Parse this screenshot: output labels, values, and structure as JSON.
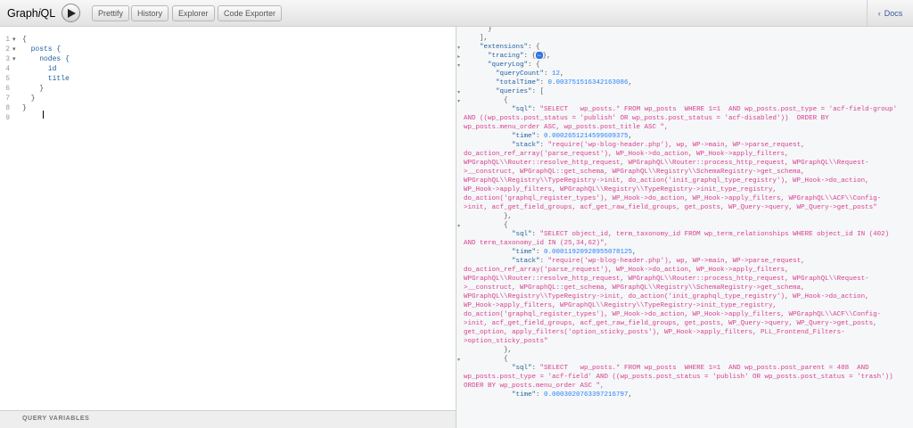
{
  "app": {
    "title_prefix": "Graph",
    "title_italic": "i",
    "title_suffix": "QL"
  },
  "toolbar": {
    "run_icon": "play-icon",
    "prettify_label": "Prettify",
    "history_label": "History",
    "explorer_label": "Explorer",
    "code_exporter_label": "Code Exporter",
    "docs_label": "Docs",
    "docs_icon": "chevron-left-icon"
  },
  "editor": {
    "line_numbers": [
      "1",
      "2",
      "3",
      "4",
      "5",
      "6",
      "7",
      "8",
      "9"
    ],
    "lines": [
      "{",
      "  posts {",
      "    nodes {",
      "      id",
      "      title",
      "    }",
      "  }",
      "}",
      ""
    ],
    "query_variables_label": "QUERY VARIABLES"
  },
  "colors": {
    "keyword": "#1f61a0",
    "number": "#2882f9",
    "string": "#d64292",
    "pill": "#2f74e6"
  },
  "result": {
    "close_obj": "}",
    "close_arr": "},",
    "extensions_key": "\"extensions\"",
    "tracing_key": "\"tracing\"",
    "tracing_pill": "↔",
    "querylog_key": "\"queryLog\"",
    "querycount_key": "\"queryCount\"",
    "querycount_val": "12",
    "totaltime_key": "\"totalTime\"",
    "totaltime_val": "0.003751516342163086",
    "queries_key": "\"queries\"",
    "sql_key": "\"sql\"",
    "time_key": "\"time\"",
    "stack_key": "\"stack\"",
    "q1_sql": [
      "\"SELECT   wp_posts.* FROM wp_posts  WHERE 1=1  AND wp_posts.post_type = 'acf-field-group'",
      "AND ((wp_posts.post_status = 'publish' OR wp_posts.post_status = 'acf-disabled'))  ORDER BY",
      "wp_posts.menu_order ASC, wp_posts.post_title ASC \","
    ],
    "q1_time": "0.0002651214599609375",
    "q1_stack": [
      "\"require('wp-blog-header.php'), wp, WP->main, WP->parse_request,",
      "do_action_ref_array('parse_request'), WP_Hook->do_action, WP_Hook->apply_filters,",
      "WPGraphQL\\\\Router::resolve_http_request, WPGraphQL\\\\Router::process_http_request, WPGraphQL\\\\Request-",
      ">__construct, WPGraphQL::get_schema, WPGraphQL\\\\Registry\\\\SchemaRegistry->get_schema,",
      "WPGraphQL\\\\Registry\\\\TypeRegistry->init, do_action('init_graphql_type_registry'), WP_Hook->do_action,",
      "WP_Hook->apply_filters, WPGraphQL\\\\Registry\\\\TypeRegistry->init_type_registry,",
      "do_action('graphql_register_types'), WP_Hook->do_action, WP_Hook->apply_filters, WPGraphQL\\\\ACF\\\\Config-",
      ">init, acf_get_field_groups, acf_get_raw_field_groups, get_posts, WP_Query->query, WP_Query->get_posts\""
    ],
    "q2_sql": [
      "\"SELECT object_id, term_taxonomy_id FROM wp_term_relationships WHERE object_id IN (402)",
      "AND term_taxonomy_id IN (25,34,62)\","
    ],
    "q2_time": "0.00011920928955078125",
    "q2_stack": [
      "\"require('wp-blog-header.php'), wp, WP->main, WP->parse_request,",
      "do_action_ref_array('parse_request'), WP_Hook->do_action, WP_Hook->apply_filters,",
      "WPGraphQL\\\\Router::resolve_http_request, WPGraphQL\\\\Router::process_http_request, WPGraphQL\\\\Request-",
      ">__construct, WPGraphQL::get_schema, WPGraphQL\\\\Registry\\\\SchemaRegistry->get_schema,",
      "WPGraphQL\\\\Registry\\\\TypeRegistry->init, do_action('init_graphql_type_registry'), WP_Hook->do_action,",
      "WP_Hook->apply_filters, WPGraphQL\\\\Registry\\\\TypeRegistry->init_type_registry,",
      "do_action('graphql_register_types'), WP_Hook->do_action, WP_Hook->apply_filters, WPGraphQL\\\\ACF\\\\Config-",
      ">init, acf_get_field_groups, acf_get_raw_field_groups, get_posts, WP_Query->query, WP_Query->get_posts,",
      "get_option, apply_filters('option_sticky_posts'), WP_Hook->apply_filters, PLL_Frontend_Filters-",
      ">option_sticky_posts\""
    ],
    "q3_sql": [
      "\"SELECT   wp_posts.* FROM wp_posts  WHERE 1=1  AND wp_posts.post_parent = 488  AND",
      "wp_posts.post_type = 'acf-field' AND ((wp_posts.post_status = 'publish' OR wp_posts.post_status = 'trash'))",
      "ORDER BY wp_posts.menu_order ASC \","
    ],
    "q3_time": "0.0003020763397216797"
  }
}
